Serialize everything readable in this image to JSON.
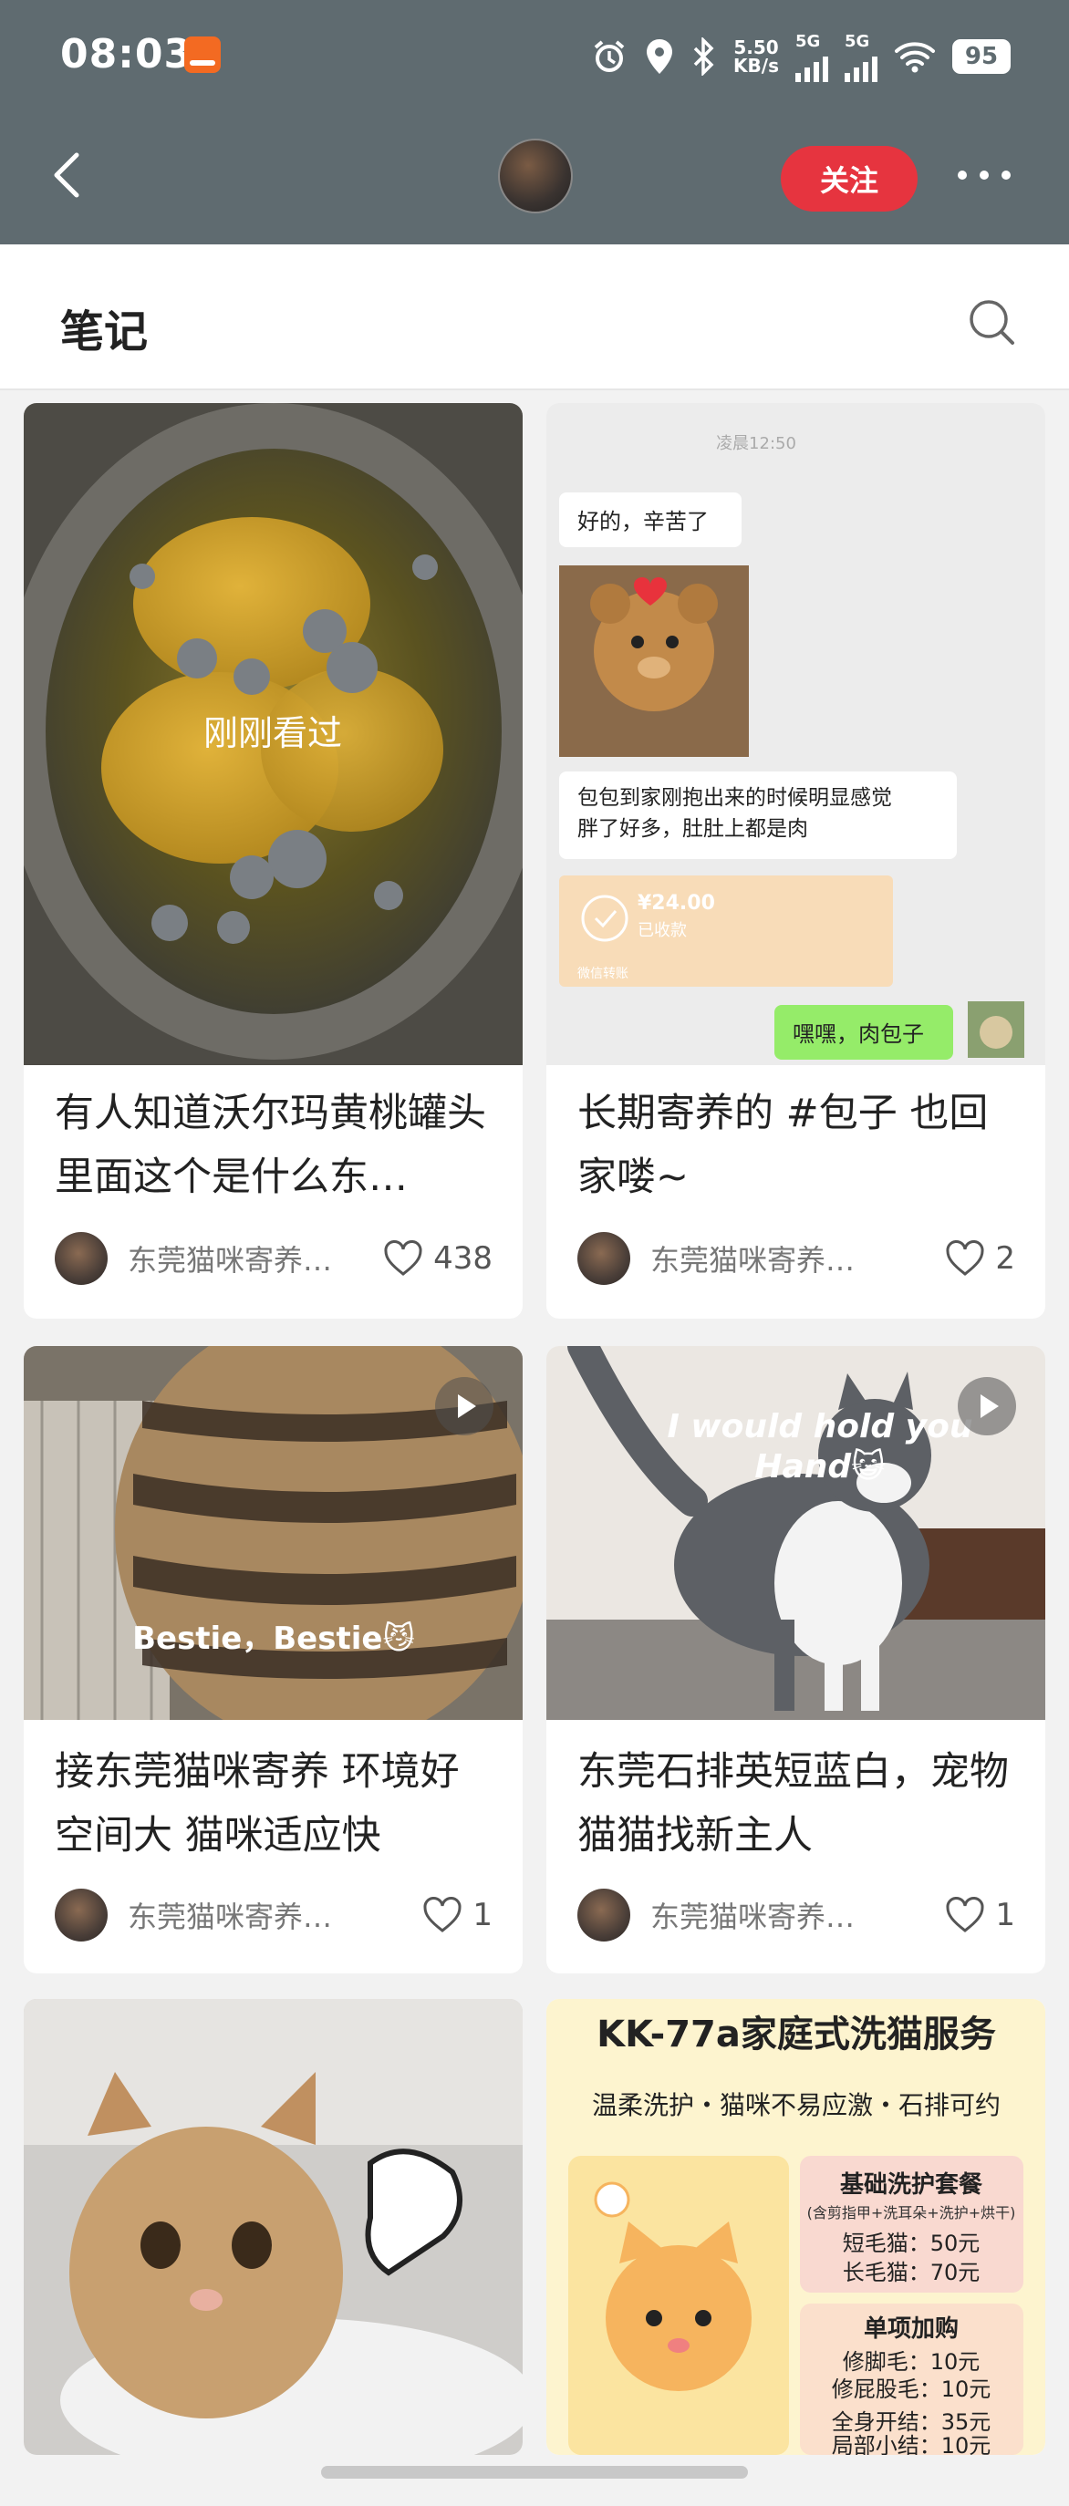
{
  "status_bar": {
    "time": "08:03",
    "net_speed_top": "5.50",
    "net_speed_unit": "KB/s",
    "sig1": "5G",
    "sig2": "5G",
    "battery": "95"
  },
  "nav": {
    "follow_label": "关注"
  },
  "section": {
    "title": "笔记"
  },
  "cards": [
    {
      "title": "有人知道沃尔玛黄桃罐头里面这个是什么东…",
      "author": "东莞猫咪寄养…",
      "likes": "438",
      "overlay": "刚刚看过"
    },
    {
      "title": "长期寄养的 #包子 也回家喽~",
      "author": "东莞猫咪寄养…",
      "likes": "2",
      "chat": {
        "time": "凌晨12:50",
        "msg1": "好的，辛苦了",
        "msg2": "包包到家刚抱出来的时候明显感觉胖了好多，肚肚上都是肉",
        "amount": "¥24.00",
        "received": "已收款",
        "transfer": "微信转账",
        "reply": "嘿嘿，肉包子"
      }
    },
    {
      "title": "接东莞猫咪寄养 环境好空间大 猫咪适应快",
      "author": "东莞猫咪寄养…",
      "likes": "1",
      "caption": "Bestie，Bestie😼"
    },
    {
      "title": "东莞石排英短蓝白，宠物猫猫找新主人",
      "author": "东莞猫咪寄养…",
      "likes": "1",
      "caption1": "I would hold you",
      "caption2": "Hand😺"
    }
  ],
  "poster": {
    "title": "KK-77a家庭式洗猫服务",
    "subtitle": "温柔洗护・猫咪不易应激・石排可约",
    "pkg_title": "基础洗护套餐",
    "pkg_note": "(含剪指甲+洗耳朵+洗护+烘干)",
    "short_hair": "短毛猫：50元",
    "long_hair": "长毛猫：70元",
    "addon_title": "单项加购",
    "addon1": "修脚毛：10元",
    "addon2": "修屁股毛：10元",
    "addon3": "全身开结：35元",
    "addon4": "局部小结：10元"
  }
}
